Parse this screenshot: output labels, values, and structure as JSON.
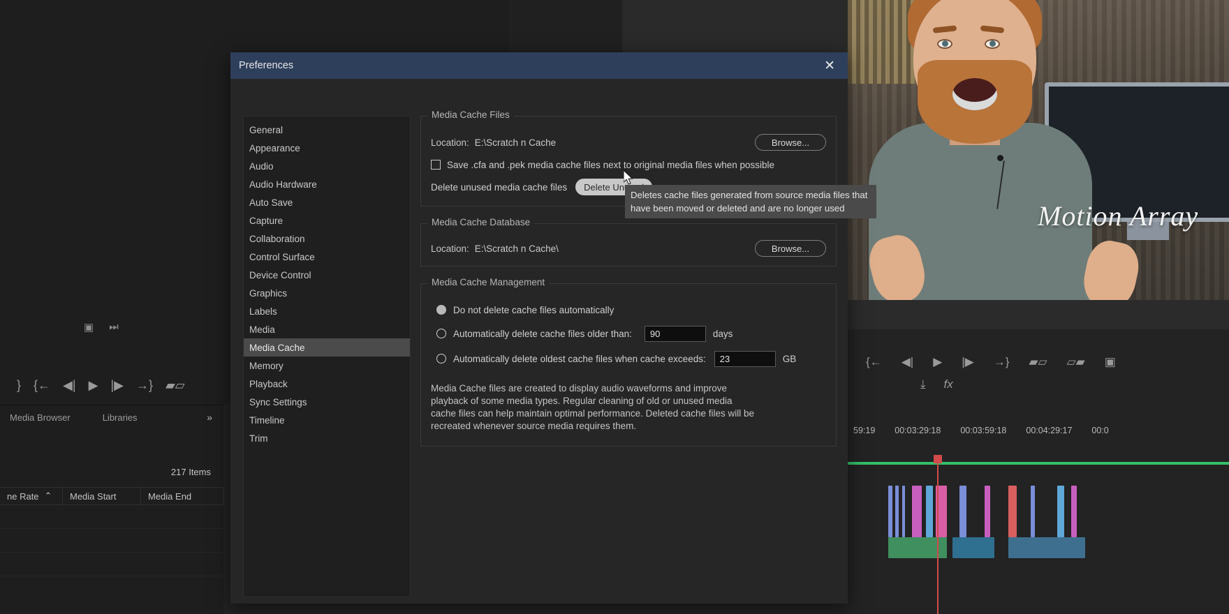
{
  "app": {
    "background": {
      "media_browser": {
        "tabs": [
          "Media Browser",
          "Libraries"
        ],
        "overflow_icon": "chevron-double-right-icon",
        "items_count": "217 Items",
        "columns": [
          "ne Rate",
          "Media Start",
          "Media End"
        ],
        "sort_icon": "sort-ascending-icon"
      },
      "timeline": {
        "timecodes": [
          "59:19",
          "00:03:29:18",
          "00:03:59:18",
          "00:04:29:17",
          "00:0"
        ]
      },
      "video_overlay_text": "Motion Array"
    }
  },
  "dialog": {
    "title": "Preferences",
    "close_icon": "close-icon",
    "sidebar": {
      "items": [
        {
          "label": "General",
          "selected": false
        },
        {
          "label": "Appearance",
          "selected": false
        },
        {
          "label": "Audio",
          "selected": false
        },
        {
          "label": "Audio Hardware",
          "selected": false
        },
        {
          "label": "Auto Save",
          "selected": false
        },
        {
          "label": "Capture",
          "selected": false
        },
        {
          "label": "Collaboration",
          "selected": false
        },
        {
          "label": "Control Surface",
          "selected": false
        },
        {
          "label": "Device Control",
          "selected": false
        },
        {
          "label": "Graphics",
          "selected": false
        },
        {
          "label": "Labels",
          "selected": false
        },
        {
          "label": "Media",
          "selected": false
        },
        {
          "label": "Media Cache",
          "selected": true
        },
        {
          "label": "Memory",
          "selected": false
        },
        {
          "label": "Playback",
          "selected": false
        },
        {
          "label": "Sync Settings",
          "selected": false
        },
        {
          "label": "Timeline",
          "selected": false
        },
        {
          "label": "Trim",
          "selected": false
        }
      ]
    },
    "media_cache_files": {
      "legend": "Media Cache Files",
      "location_label": "Location:",
      "location_value": "E:\\Scratch n Cache",
      "browse_label": "Browse...",
      "save_checkbox_label": "Save .cfa and .pek media cache files next to original media files when possible",
      "save_checkbox_checked": false,
      "delete_unused_label": "Delete unused media cache files",
      "delete_unused_button": "Delete Unused"
    },
    "media_cache_database": {
      "legend": "Media Cache Database",
      "location_label": "Location:",
      "location_value": "E:\\Scratch n Cache\\",
      "browse_label": "Browse..."
    },
    "media_cache_management": {
      "legend": "Media Cache Management",
      "options": [
        {
          "label": "Do not delete cache files automatically",
          "selected": true
        },
        {
          "label": "Automatically delete cache files older than:",
          "selected": false,
          "value": "90",
          "unit": "days"
        },
        {
          "label": "Automatically delete oldest cache files when cache exceeds:",
          "selected": false,
          "value": "23",
          "unit": "GB"
        }
      ],
      "description": "Media Cache files are created to display audio waveforms and improve playback of some media types.  Regular cleaning of old or unused media cache files can help maintain optimal performance. Deleted cache files will be recreated whenever source media requires them."
    },
    "tooltip": {
      "text": "Deletes cache files generated from source media files that have been moved or deleted and are no longer used"
    }
  },
  "colors": {
    "title_bar": "#2e3f5c",
    "dialog_bg": "#262626",
    "sidebar_selected": "#4b4b4b",
    "tooltip_bg": "#4a4a4a",
    "button_hover": "#c8c8c8",
    "timeline_green": "#35c06a",
    "playhead_red": "#d24a4a"
  }
}
